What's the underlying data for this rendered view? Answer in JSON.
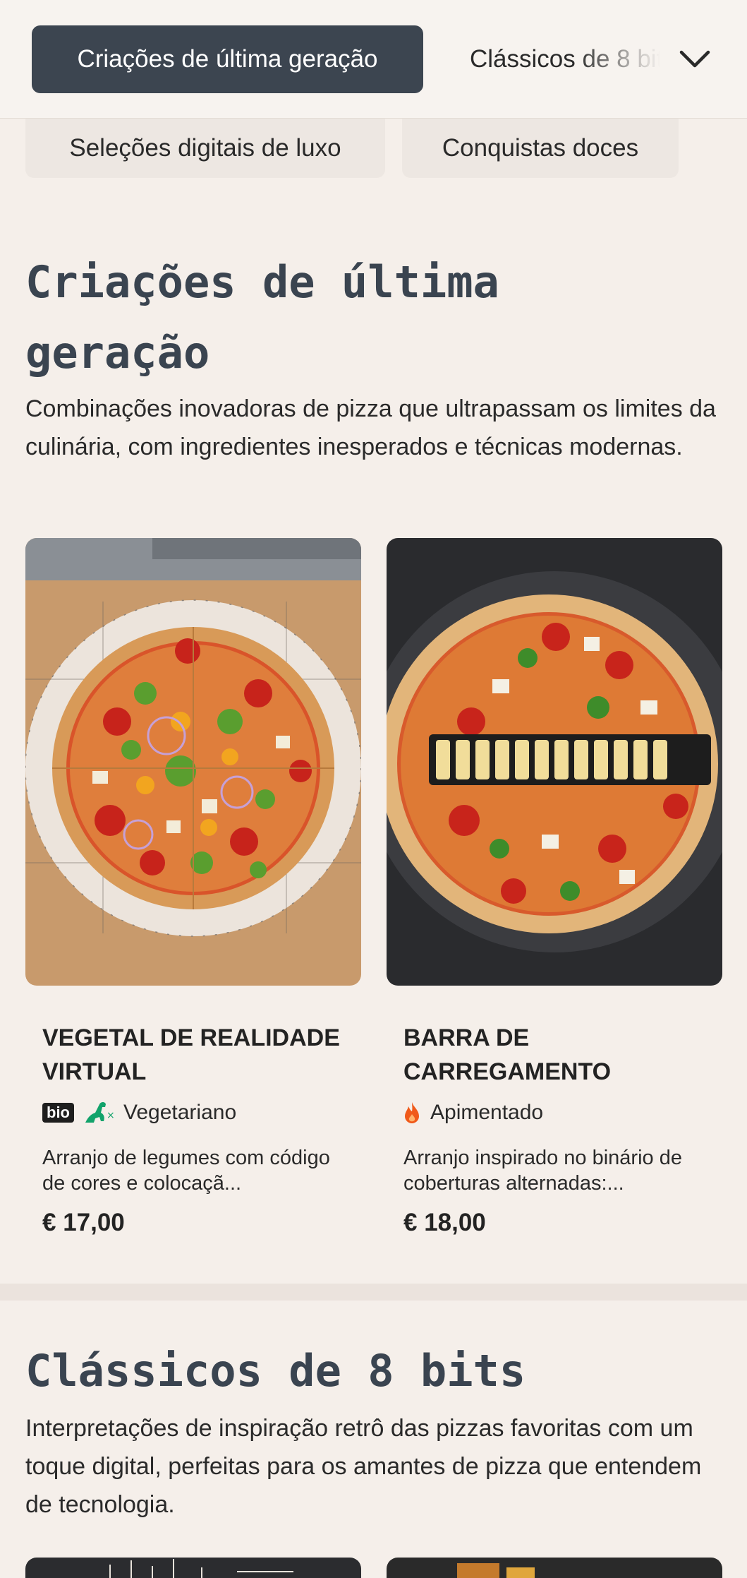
{
  "nav": {
    "active_tab": "Criações de última geração",
    "next_tab": "Clássicos de 8 bits",
    "subtabs": [
      "Seleções digitais de luxo",
      "Conquistas doces"
    ]
  },
  "section1": {
    "title": "Criações de última geração",
    "description": "Combinações inovadoras de pizza que ultrapassam os limites da culinária, com ingredientes inesperados e técnicas modernas.",
    "items": [
      {
        "name": "Vegetal de realidade virtual",
        "badge": "bio",
        "tag": "Vegetariano",
        "tag_icon": "dinosaur-icon",
        "description": "Arranjo de legumes com código de cores e colocaçã...",
        "price": "€ 17,00"
      },
      {
        "name": "Barra de carregamento",
        "tag": "Apimentado",
        "tag_icon": "flame-icon",
        "description": "Arranjo inspirado no binário de coberturas alternadas:...",
        "price": "€ 18,00"
      }
    ]
  },
  "section2": {
    "title": "Clássicos de 8 bits",
    "description": "Interpretações de inspiração retrô das pizzas favoritas com um toque digital, perfeitas para os amantes de pizza que entendem de tecnologia."
  },
  "colors": {
    "background": "#f5efea",
    "active_tab": "#3c4550",
    "title": "#3a4450",
    "veg_green": "#12a36b",
    "spicy_orange": "#f05a1a"
  }
}
